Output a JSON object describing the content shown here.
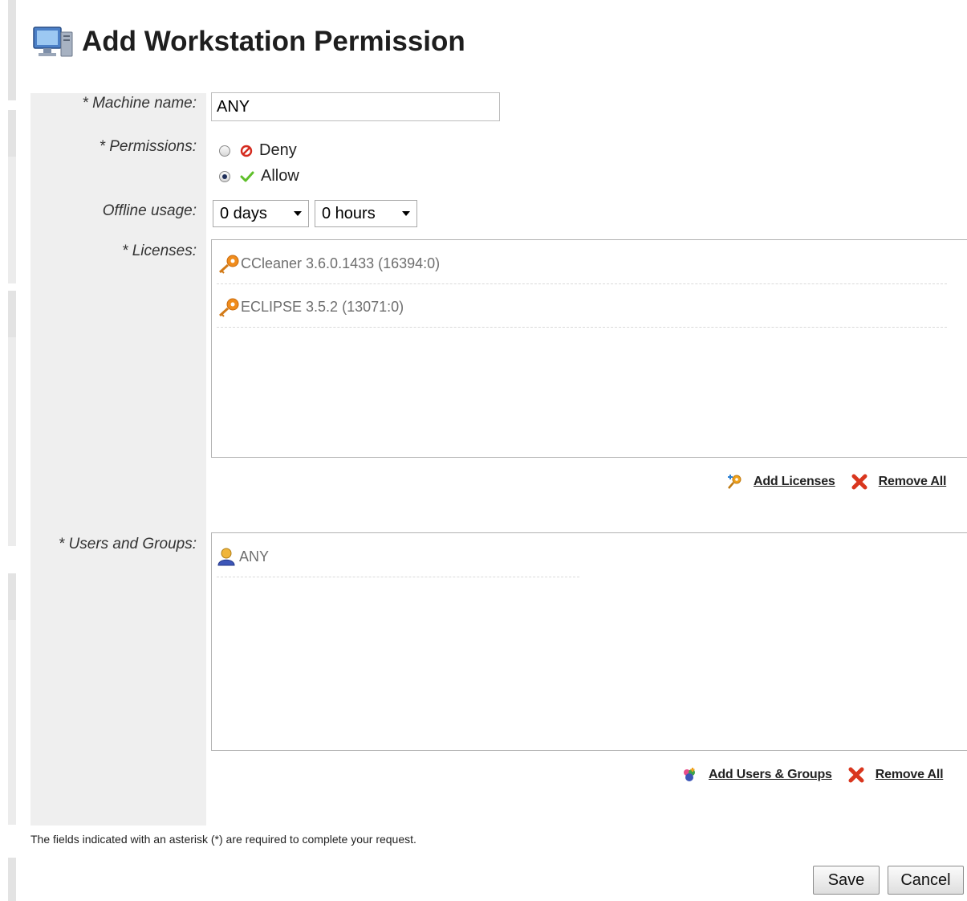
{
  "page": {
    "title": "Add Workstation Permission"
  },
  "form": {
    "machine_name": {
      "label": "* Machine name:",
      "value": "ANY"
    },
    "permissions": {
      "label": "* Permissions:",
      "options": [
        {
          "label": "Deny",
          "selected": false,
          "icon": "deny-icon"
        },
        {
          "label": "Allow",
          "selected": true,
          "icon": "allow-checkmark-icon"
        }
      ]
    },
    "offline_usage": {
      "label": "Offline usage:",
      "days": "0 days",
      "hours": "0 hours"
    },
    "licenses": {
      "label": "* Licenses:",
      "items": [
        {
          "text": "CCleaner 3.6.0.1433 (16394:0)",
          "icon": "key-icon"
        },
        {
          "text": "ECLIPSE 3.5.2 (13071:0)",
          "icon": "key-icon"
        }
      ],
      "add_label": "Add Licenses",
      "remove_label": "Remove All"
    },
    "users_groups": {
      "label": "* Users and Groups:",
      "items": [
        {
          "text": "ANY",
          "icon": "user-icon"
        }
      ],
      "add_label": "Add Users & Groups",
      "remove_label": "Remove All"
    }
  },
  "footer": {
    "note": "The fields indicated with an asterisk (*) are required to complete your request.",
    "save_label": "Save",
    "cancel_label": "Cancel"
  },
  "colors": {
    "label_column_bg": "#efefef",
    "deny_red": "#d42a1e",
    "allow_green": "#5fbf2a",
    "key_orange": "#f08c1c",
    "remove_red": "#d9361e"
  }
}
